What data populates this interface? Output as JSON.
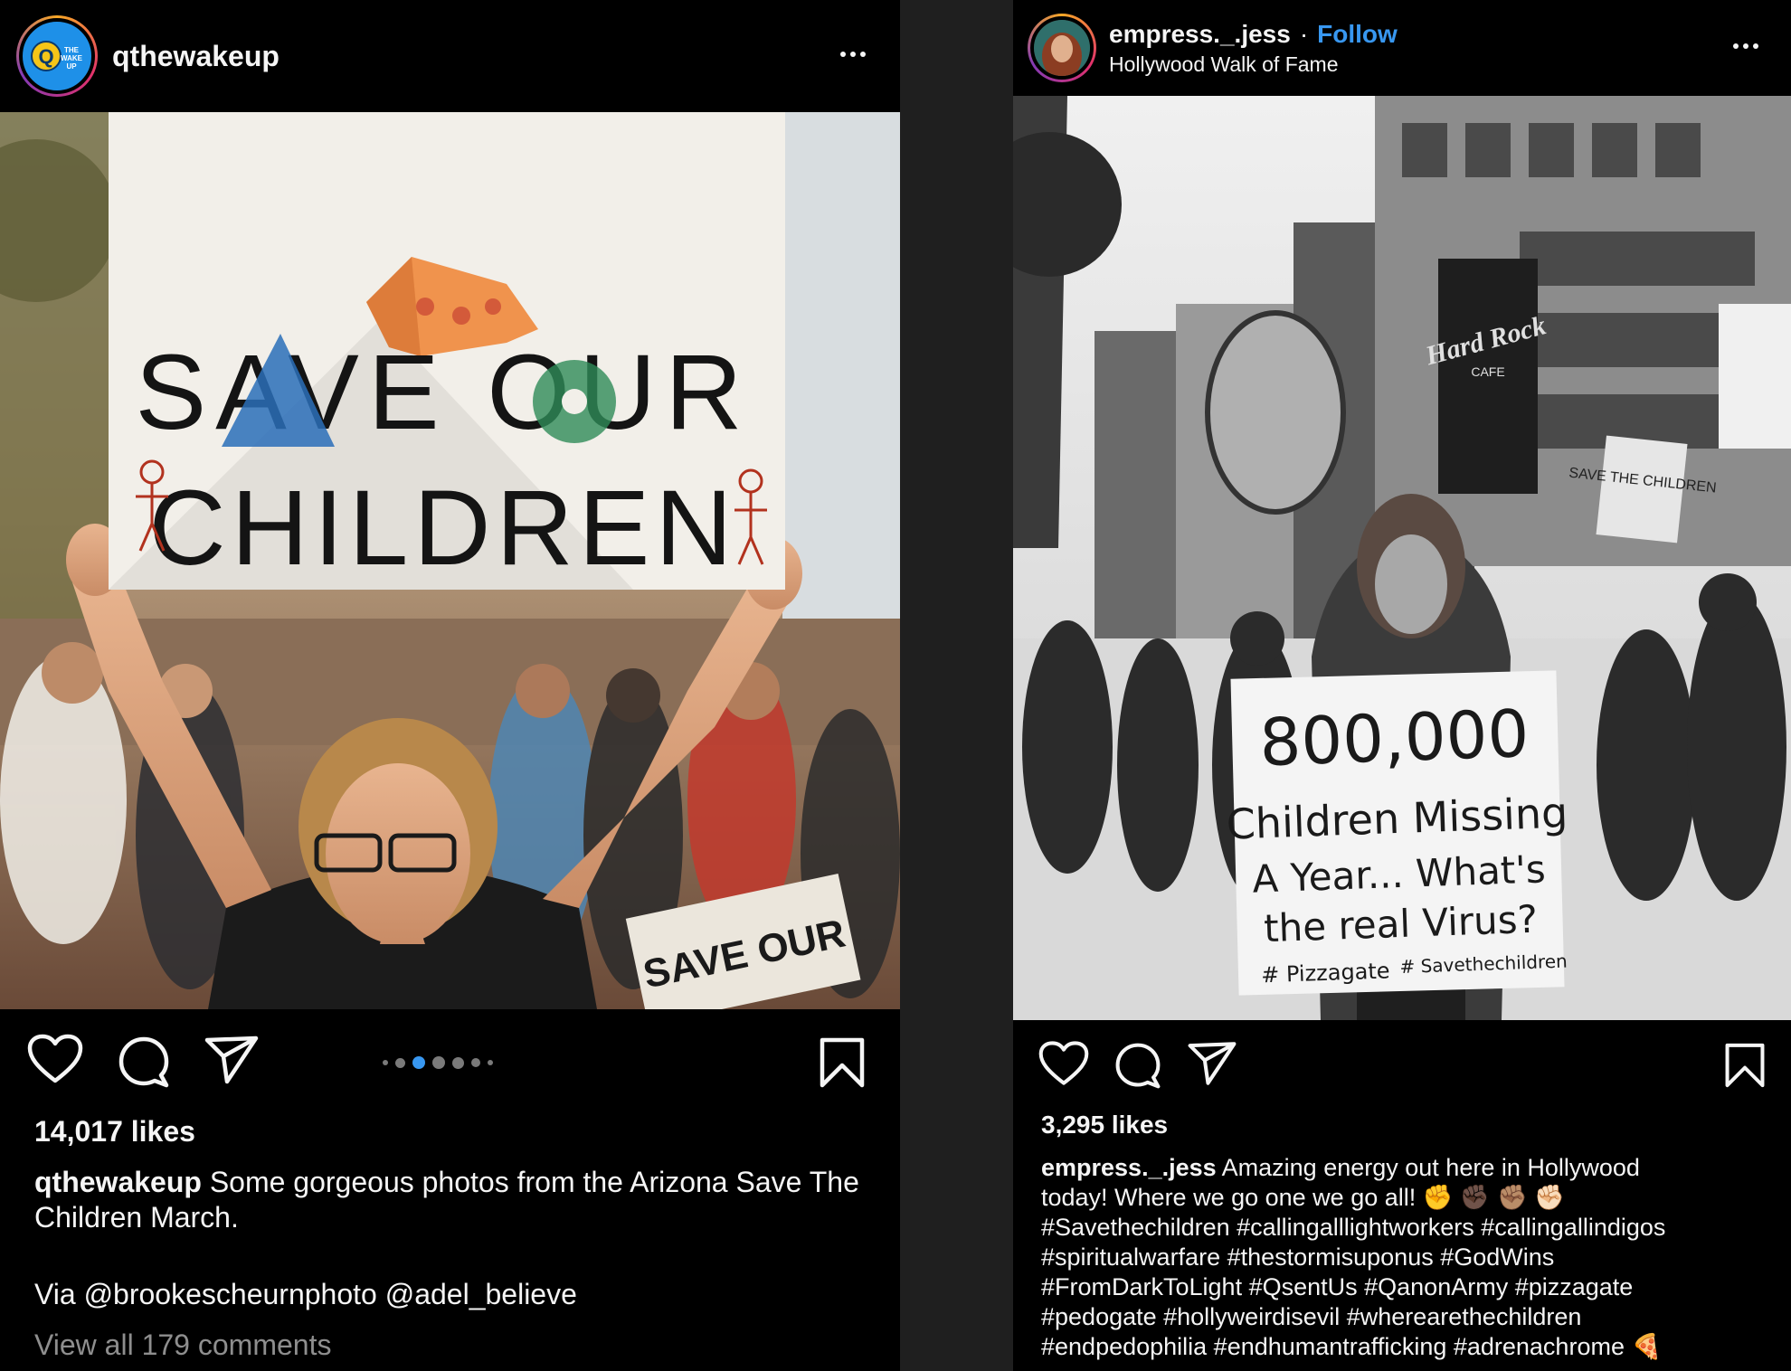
{
  "left_post": {
    "username": "qthewakeup",
    "avatar_text": "THE WAKE UP",
    "avatar_letter": "Q",
    "sign_line1": "SAVE OUR",
    "sign_line2": "CHILDREN",
    "background_sign": "SAVE OUR",
    "likes": "14,017 likes",
    "caption_user": "qthewakeup",
    "caption_text": "Some gorgeous photos from the Arizona Save The Children March.",
    "caption_via": "Via @brookescheurnphoto @adel_believe",
    "view_comments": "View all 179 comments",
    "carousel_total": 7,
    "carousel_active": 2
  },
  "right_post": {
    "username": "empress._.jess",
    "separator": "·",
    "follow_label": "Follow",
    "location": "Hollywood Walk of Fame",
    "sign_line1": "800,000",
    "sign_line2": "Children Missing",
    "sign_line3": "A Year... What's",
    "sign_line4": "the real Virus?",
    "sign_tag1": "# Pizzagate",
    "sign_tag2": "# Savethechildren",
    "storefront": "Hard Rock",
    "storefront_sub": "CAFE",
    "side_sign": "SAVE THE CHILDREN",
    "likes": "3,295 likes",
    "caption_user": "empress._.jess",
    "caption_line1": "Amazing energy out here in Hollywood",
    "caption_line2": "today! Where we go one we go all! ✊ ✊🏿 ✊🏽 ✊🏻",
    "caption_line3": "#Savethechildren #callingalllightworkers #callingallindigos",
    "caption_line4": "#spiritualwarfare #thestormisuponus #GodWins",
    "caption_line5": "#FromDarkToLight #QsentUs #QanonArmy #pizzagate",
    "caption_line6": "#pedogate #hollyweirdisevil #wherearethechildren",
    "caption_line7": "#endpedophilia #endhumantrafficking #adrenachrome 🍕"
  },
  "icons": [
    "heart-icon",
    "comment-icon",
    "share-icon",
    "bookmark-icon",
    "more-options-icon"
  ]
}
